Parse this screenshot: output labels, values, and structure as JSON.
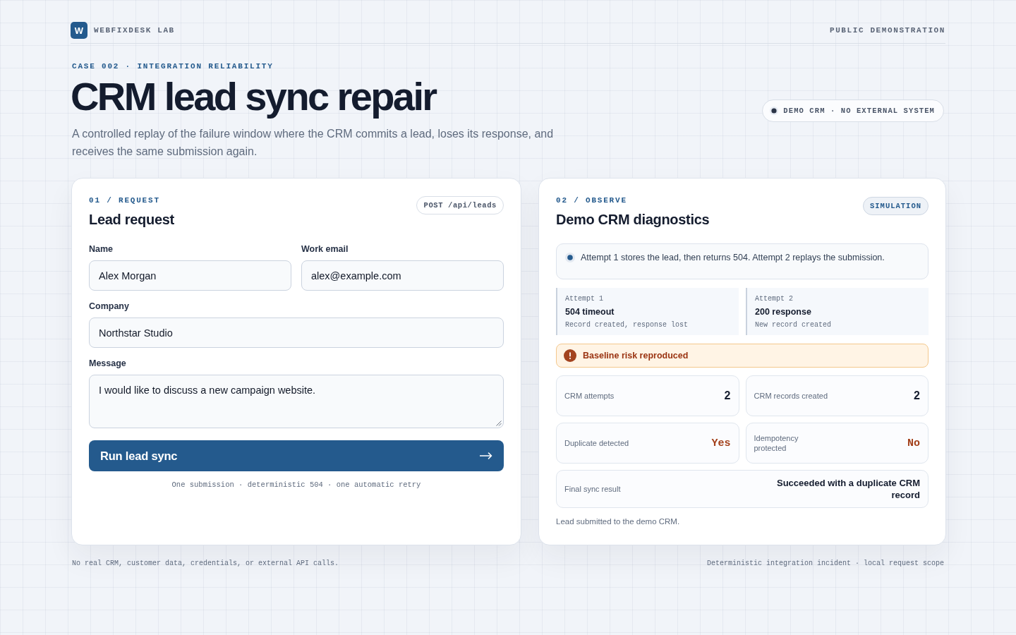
{
  "header": {
    "logo": "W",
    "brand": "WEBFIXDESK LAB",
    "tagline": "PUBLIC DEMONSTRATION"
  },
  "hero": {
    "eyebrow": "CASE 002 · INTEGRATION RELIABILITY",
    "title": "CRM lead sync repair",
    "subtitle": "A controlled replay of the failure window where the CRM commits a lead, loses its response, and receives the same submission again.",
    "scope": "DEMO CRM · NO EXTERNAL SYSTEM"
  },
  "request_panel": {
    "step": "01 / REQUEST",
    "title": "Lead request",
    "endpoint": "POST /api/leads",
    "field_rows": [
      [
        {
          "label": "Name",
          "value": "Alex Morgan",
          "kind": "input"
        },
        {
          "label": "Work email",
          "value": "alex@example.com",
          "kind": "input"
        }
      ],
      [
        {
          "label": "Company",
          "value": "Northstar Studio",
          "kind": "input"
        }
      ],
      [
        {
          "label": "Message",
          "value": "I would like to discuss a new campaign website.",
          "kind": "textarea"
        }
      ]
    ],
    "button": "Run lead sync",
    "note": "One submission · deterministic 504 · one automatic retry"
  },
  "observe_panel": {
    "step": "02 / OBSERVE",
    "title": "Demo CRM diagnostics",
    "mode": "SIMULATION",
    "summary": "Attempt 1 stores the lead, then returns 504. Attempt 2 replays the submission.",
    "attempts": [
      {
        "label": "Attempt 1",
        "status": "504 timeout",
        "detail": "Record created, response lost"
      },
      {
        "label": "Attempt 2",
        "status": "200 response",
        "detail": "New record created"
      }
    ],
    "alert": {
      "kind": "warning",
      "text": "Baseline risk reproduced"
    },
    "metrics": [
      {
        "label": "CRM attempts",
        "value": "2",
        "kind": "count"
      },
      {
        "label": "CRM records created",
        "value": "2",
        "kind": "count"
      },
      {
        "label": "Duplicate detected",
        "value": "Yes",
        "kind": "flag"
      },
      {
        "label": "Idempotency protected",
        "value": "No",
        "kind": "flag"
      }
    ],
    "result": {
      "label": "Final sync result",
      "value": "Succeeded with a duplicate CRM record"
    },
    "status_note": "Lead submitted to the demo CRM."
  },
  "footer": {
    "left": "No real CRM, customer data, credentials, or external API calls.",
    "right": "Deterministic integration incident · local request scope"
  }
}
